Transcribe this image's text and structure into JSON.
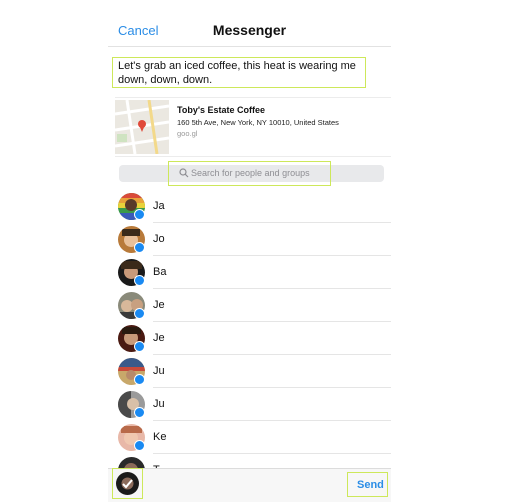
{
  "nav": {
    "cancel_label": "Cancel",
    "title": "Messenger"
  },
  "compose": {
    "message": "Let's grab an iced coffee, this heat is wearing me down, down, down."
  },
  "link_card": {
    "title": "Toby's Estate Coffee",
    "address": "160 5th Ave, New York, NY 10010, United States",
    "domain": "goo.gl"
  },
  "search": {
    "placeholder": "Search for people and groups"
  },
  "contacts": [
    {
      "name": "Ja",
      "avatar_color": "#5a7a2f"
    },
    {
      "name": "Jo",
      "avatar_color": "#8a5a2a"
    },
    {
      "name": "Ba",
      "avatar_color": "#3a2a1a"
    },
    {
      "name": "Je",
      "avatar_color": "#6a5c48"
    },
    {
      "name": "Je",
      "avatar_color": "#5a1a12"
    },
    {
      "name": "Ju",
      "avatar_color": "#7a6a3a"
    },
    {
      "name": "Ju",
      "avatar_color": "#5a5a5a"
    },
    {
      "name": "Ke",
      "avatar_color": "#c27a6a"
    },
    {
      "name": "T",
      "avatar_color": "#2a2a2a"
    }
  ],
  "bottom_bar": {
    "send_label": "Send"
  },
  "colors": {
    "accent": "#2b8de6",
    "badge": "#1a8af2",
    "highlight": "#cde85a"
  },
  "icons": {
    "search": "search-icon",
    "map_pin": "map-pin-icon",
    "messenger_badge": "messenger-badge-icon"
  }
}
